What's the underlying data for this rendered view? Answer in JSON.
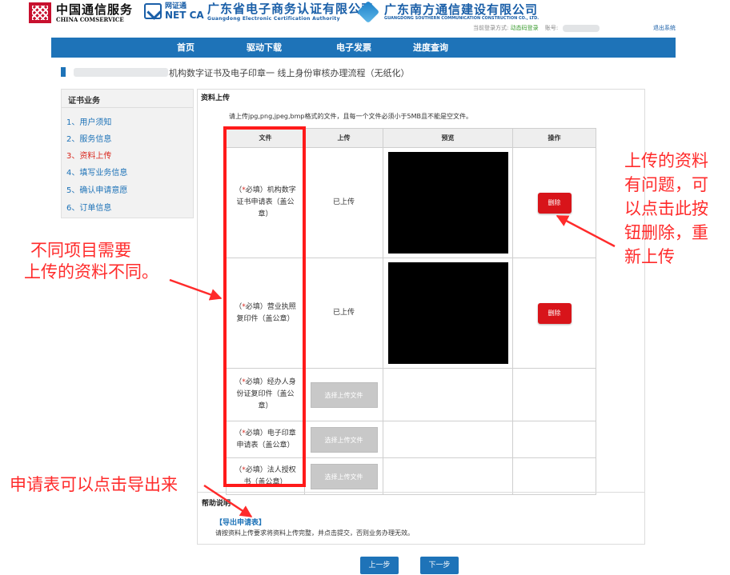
{
  "header": {
    "logo1": {
      "title": "中国通信服务",
      "subtitle": "CHINA COMSERVICE"
    },
    "logo2": {
      "line1": "网证通",
      "line2": "NET CA"
    },
    "logo3": {
      "title": "广东省电子商务认证有限公司",
      "subtitle": "Guangdong Electronic Certification Authority"
    },
    "logo4": {
      "title": "广东南方通信建设有限公司",
      "subtitle": "GUANGDONG SOUTHERN COMMUNICATION CONSTRUCTION CO., LTD."
    },
    "login_label": "当前登录方式:",
    "login_method": "动态码登录",
    "account_label": "账号:",
    "logout": "退出系统"
  },
  "nav": {
    "items": [
      "首页",
      "驱动下载",
      "电子发票",
      "进度查询"
    ]
  },
  "page_title": "机构数字证书及电子印章一 线上身份审核办理流程（无纸化）",
  "sidebar": {
    "title": "证书业务",
    "items": [
      "1、用户须知",
      "2、服务信息",
      "3、资料上传",
      "4、填写业务信息",
      "5、确认申请意愿",
      "6、订单信息"
    ],
    "active_index": 2
  },
  "upload": {
    "section_title": "资料上传",
    "description": "请上传jpg,png,jpeg,bmp格式的文件，且每一个文件必须小于5MB且不能是空文件。",
    "columns": [
      "文件",
      "上传",
      "预览",
      "操作"
    ],
    "required_prefix_open": "（",
    "required_star": "*",
    "required_word": "必填）",
    "rows": [
      {
        "file": "机构数字证书申请表（盖公章）",
        "status": "已上传",
        "has_preview": true,
        "action": "删除"
      },
      {
        "file": "营业执照复印件（盖公章）",
        "status": "已上传",
        "has_preview": true,
        "action": "删除"
      },
      {
        "file": "经办人身份证复印件（盖公章）",
        "upload_label": "选择上传文件"
      },
      {
        "file": "电子印章申请表（盖公章）",
        "upload_label": "选择上传文件"
      },
      {
        "file": "法人授权书（盖公章）",
        "upload_label": "选择上传文件"
      }
    ]
  },
  "help": {
    "title": "帮助说明",
    "export_link": "【导出申请表】",
    "text": "请按资料上传要求将资料上传完整，并点击提交，否则业务办理无效。"
  },
  "buttons": {
    "prev": "上一步",
    "next": "下一步"
  },
  "annotations": {
    "left_note_line1": "不同项目需要",
    "left_note_line2": "上传的资料不同。",
    "right_note_lines": [
      "上传的资料",
      "有问题，可",
      "以点击此按",
      "钮删除，重",
      "新上传"
    ],
    "bottom_note": "申请表可以点击导出来",
    "color": "#ff2b2b"
  },
  "colors": {
    "brand_blue": "#1e73b8",
    "delete_red": "#d8141a",
    "annotation_red": "#ff1a1a"
  }
}
